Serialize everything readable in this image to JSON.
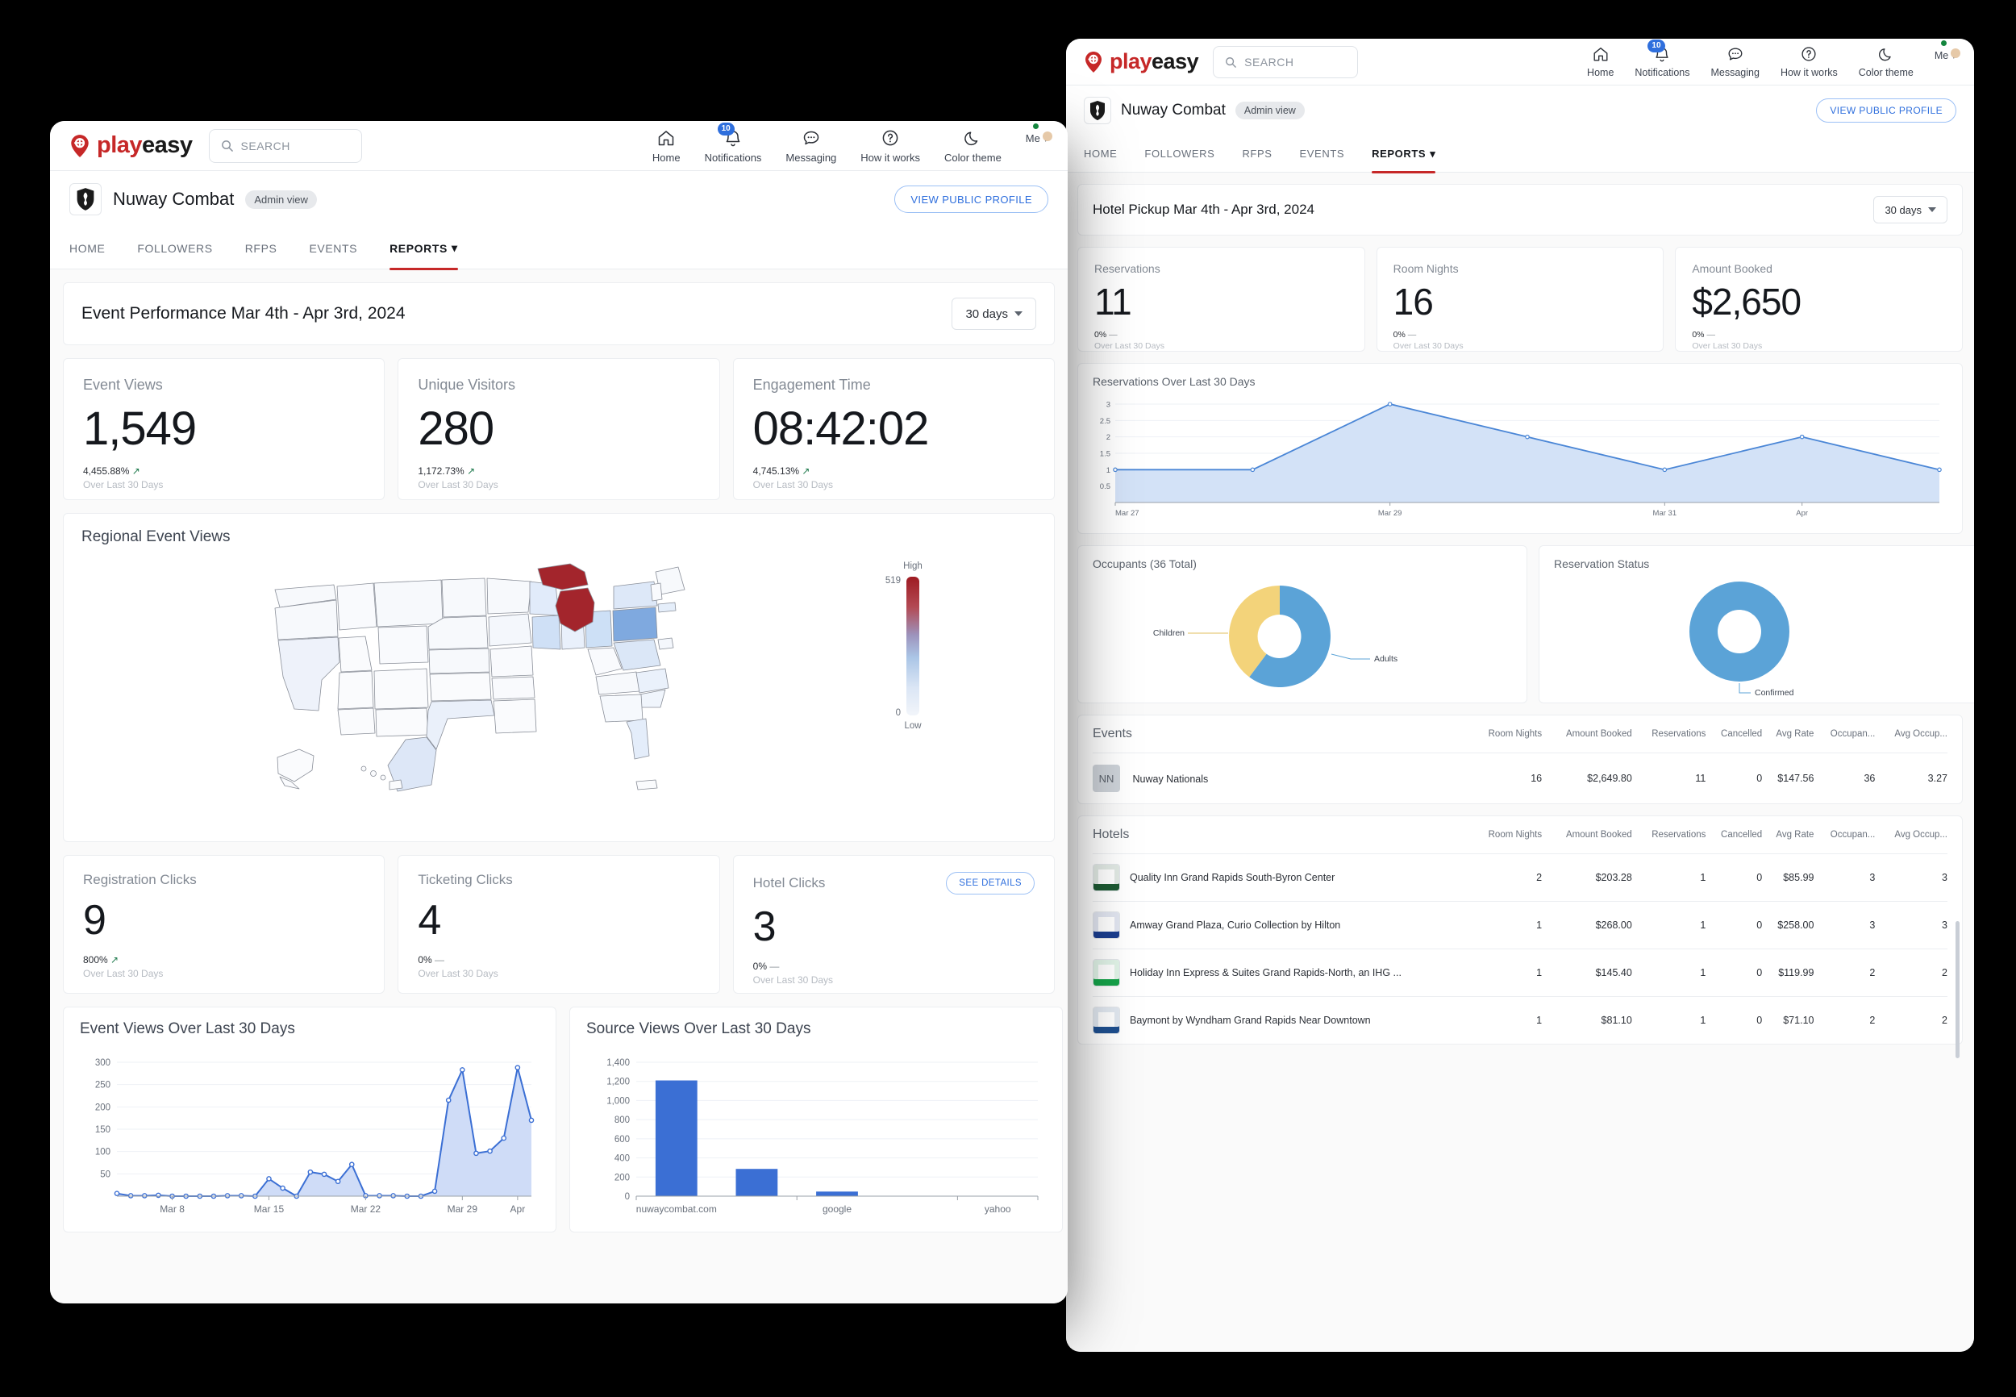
{
  "brand": {
    "play": "play",
    "easy": "easy"
  },
  "search": {
    "placeholder": "SEARCH"
  },
  "nav": [
    {
      "label": "Home",
      "icon": "home-icon"
    },
    {
      "label": "Notifications",
      "icon": "bell-icon",
      "badge": "10"
    },
    {
      "label": "Messaging",
      "icon": "chat-icon"
    },
    {
      "label": "How it works",
      "icon": "question-icon"
    },
    {
      "label": "Color theme",
      "icon": "moon-icon"
    },
    {
      "label": "Me",
      "icon": "avatar"
    }
  ],
  "org": {
    "name": "Nuway Combat",
    "badge": "Admin view",
    "view_public": "VIEW PUBLIC PROFILE"
  },
  "tabs": [
    {
      "label": "HOME",
      "active": false
    },
    {
      "label": "FOLLOWERS",
      "active": false
    },
    {
      "label": "RFPS",
      "active": false
    },
    {
      "label": "EVENTS",
      "active": false
    },
    {
      "label": "REPORTS",
      "active": true,
      "caret": true
    }
  ],
  "front": {
    "header_title": "Event Performance Mar 4th - Apr 3rd, 2024",
    "range_label": "30 days",
    "kpis": [
      {
        "label": "Event Views",
        "value": "1,549",
        "delta": "4,455.88%",
        "trend": "up",
        "sub": "Over Last 30 Days"
      },
      {
        "label": "Unique Visitors",
        "value": "280",
        "delta": "1,172.73%",
        "trend": "up",
        "sub": "Over Last 30 Days"
      },
      {
        "label": "Engagement Time",
        "value": "08:42:02",
        "delta": "4,745.13%",
        "trend": "up",
        "sub": "Over Last 30 Days"
      }
    ],
    "map": {
      "title": "Regional Event Views",
      "legend_high": "High",
      "legend_low": "Low",
      "legend_max": "519",
      "legend_min": "0"
    },
    "clicks": [
      {
        "label": "Registration Clicks",
        "value": "9",
        "delta": "800%",
        "trend": "up",
        "sub": "Over Last 30 Days"
      },
      {
        "label": "Ticketing Clicks",
        "value": "4",
        "delta": "0%",
        "trend": "flat",
        "sub": "Over Last 30 Days"
      },
      {
        "label": "Hotel Clicks",
        "value": "3",
        "delta": "0%",
        "trend": "flat",
        "sub": "Over Last 30 Days",
        "action": "SEE DETAILS"
      }
    ]
  },
  "back": {
    "header_title": "Hotel Pickup Mar 4th - Apr 3rd, 2024",
    "range_label": "30 days",
    "kpis": [
      {
        "label": "Reservations",
        "value": "11",
        "delta": "0%",
        "trend": "flat",
        "sub": "Over Last 30 Days"
      },
      {
        "label": "Room Nights",
        "value": "16",
        "delta": "0%",
        "trend": "flat",
        "sub": "Over Last 30 Days"
      },
      {
        "label": "Amount Booked",
        "value": "$2,650",
        "delta": "0%",
        "trend": "flat",
        "sub": "Over Last 30 Days"
      }
    ],
    "events_table": {
      "title": "Events",
      "columns": [
        "Room Nights",
        "Amount Booked",
        "Reservations",
        "Cancelled",
        "Avg Rate",
        "Occupan...",
        "Avg Occup..."
      ],
      "rows": [
        {
          "initials": "NN",
          "name": "Nuway Nationals",
          "cells": [
            "16",
            "$2,649.80",
            "11",
            "0",
            "$147.56",
            "36",
            "3.27"
          ]
        }
      ]
    },
    "hotels_table": {
      "title": "Hotels",
      "columns": [
        "Room Nights",
        "Amount Booked",
        "Reservations",
        "Cancelled",
        "Avg Rate",
        "Occupan...",
        "Avg Occup..."
      ],
      "rows": [
        {
          "name": "Quality Inn Grand Rapids South-Byron Center",
          "cells": [
            "2",
            "$203.28",
            "1",
            "0",
            "$85.99",
            "3",
            "3"
          ]
        },
        {
          "name": "Amway Grand Plaza, Curio Collection by Hilton",
          "cells": [
            "1",
            "$268.00",
            "1",
            "0",
            "$258.00",
            "3",
            "3"
          ]
        },
        {
          "name": "Holiday Inn Express & Suites Grand Rapids-North, an IHG ...",
          "cells": [
            "1",
            "$145.40",
            "1",
            "0",
            "$119.99",
            "2",
            "2"
          ]
        },
        {
          "name": "Baymont by Wyndham Grand Rapids Near Downtown",
          "cells": [
            "1",
            "$81.10",
            "1",
            "0",
            "$71.10",
            "2",
            "2"
          ]
        }
      ]
    }
  },
  "chart_data": [
    {
      "id": "event_views",
      "type": "area",
      "title": "Event Views Over Last 30 Days",
      "xlabel": "",
      "ylabel": "",
      "ylim": [
        0,
        300
      ],
      "yticks": [
        50,
        100,
        150,
        200,
        250,
        300
      ],
      "xticks": [
        "Mar 8",
        "Mar 15",
        "Mar 22",
        "Mar 29",
        "Apr"
      ],
      "x": [
        "Mar 4",
        "Mar 5",
        "Mar 6",
        "Mar 7",
        "Mar 8",
        "Mar 9",
        "Mar 10",
        "Mar 11",
        "Mar 12",
        "Mar 13",
        "Mar 14",
        "Mar 15",
        "Mar 16",
        "Mar 17",
        "Mar 18",
        "Mar 19",
        "Mar 20",
        "Mar 21",
        "Mar 22",
        "Mar 23",
        "Mar 24",
        "Mar 25",
        "Mar 26",
        "Mar 27",
        "Mar 28",
        "Mar 29",
        "Mar 30",
        "Mar 31",
        "Apr 1",
        "Apr 2",
        "Apr 3"
      ],
      "values": [
        6,
        1,
        1,
        2,
        0,
        0,
        0,
        0,
        1,
        1,
        0,
        39,
        18,
        0,
        54,
        49,
        33,
        71,
        1,
        1,
        1,
        0,
        0,
        11,
        215,
        283,
        96,
        101,
        130,
        288,
        170
      ],
      "line_color": "#3b6fd4",
      "fill_color": "#cfdcf7",
      "grid": true
    },
    {
      "id": "source_views",
      "type": "bar",
      "title": "Source Views Over Last 30 Days",
      "xlabel": "",
      "ylabel": "",
      "ylim": [
        0,
        1400
      ],
      "yticks": [
        0,
        200,
        400,
        600,
        800,
        1000,
        1200,
        1400
      ],
      "ytick_labels": [
        "0",
        "200",
        "400",
        "600",
        "800",
        "1,000",
        "1,200",
        "1,400"
      ],
      "categories": [
        "nuwaycombat.com",
        "",
        "google",
        "",
        "yahoo"
      ],
      "values": [
        1210,
        285,
        48,
        2,
        1
      ],
      "bar_color": "#3b6fd4",
      "grid": true
    },
    {
      "id": "reservations",
      "type": "area",
      "title": "Reservations Over Last 30 Days",
      "xlabel": "",
      "ylabel": "",
      "ylim": [
        0,
        3
      ],
      "yticks": [
        0.5,
        1,
        1.5,
        2,
        2.5,
        3
      ],
      "ytick_labels": [
        "0.5",
        "1",
        "1.5",
        "2",
        "2.5",
        "3"
      ],
      "xticks": [
        "Mar 27",
        "Mar 29",
        "Mar 31",
        "Apr"
      ],
      "x": [
        "Mar 27",
        "Mar 28",
        "Mar 29",
        "Mar 30",
        "Mar 31",
        "Apr 1",
        "Apr 2"
      ],
      "values": [
        1,
        1,
        3,
        2,
        1,
        2,
        1
      ],
      "line_color": "#4a86d6",
      "fill_color": "#d3e2f7",
      "grid": true
    },
    {
      "id": "occupants",
      "type": "pie",
      "title": "Occupants (36 Total)",
      "labels": [
        "Adults",
        "Children"
      ],
      "values": [
        21,
        15
      ],
      "colors": [
        "#5ba3d7",
        "#f3d37a"
      ],
      "donut": true,
      "legend": "callout"
    },
    {
      "id": "reservation_status",
      "type": "pie",
      "title": "Reservation Status",
      "labels": [
        "Confirmed"
      ],
      "values": [
        11
      ],
      "colors": [
        "#5ba3d7"
      ],
      "donut": true,
      "legend": "callout"
    }
  ]
}
